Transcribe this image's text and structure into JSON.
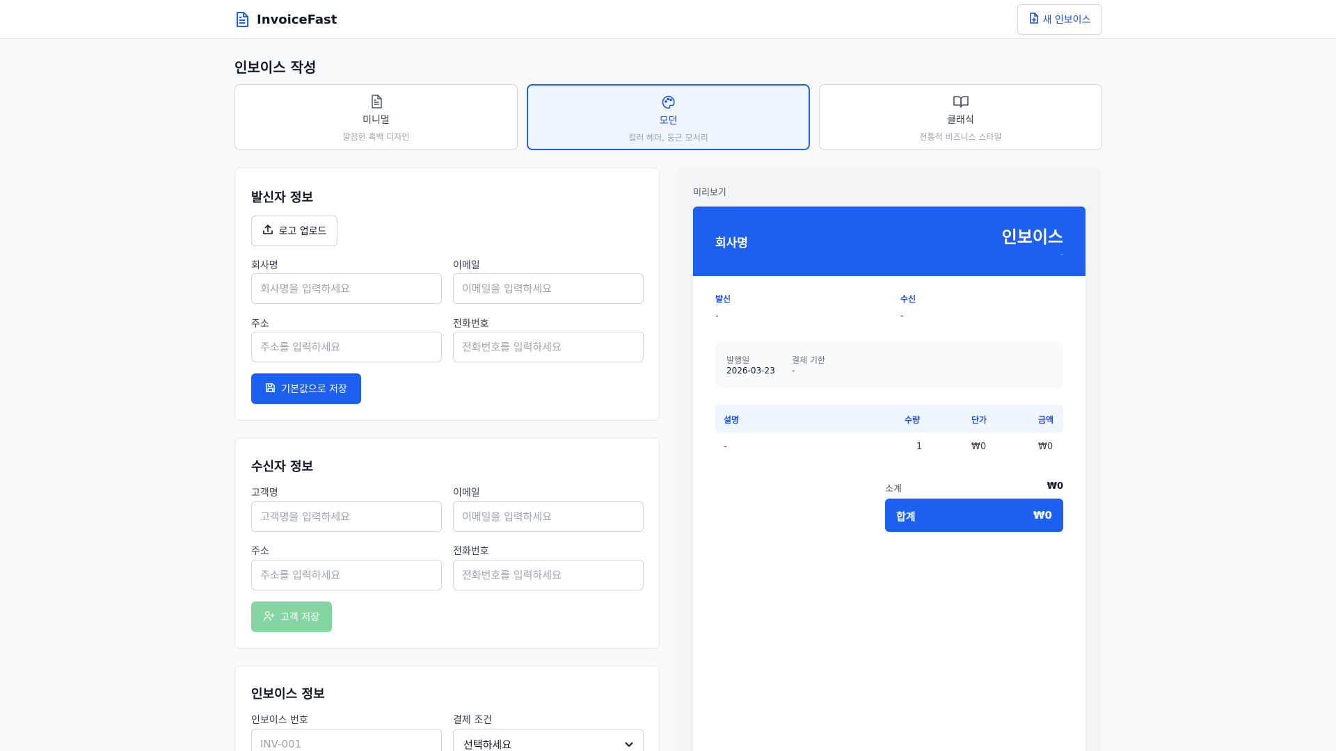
{
  "app": {
    "name": "InvoiceFast",
    "new_invoice_label": "새 인보이스"
  },
  "page": {
    "title": "인보이스 작성"
  },
  "templates": [
    {
      "name": "미니멀",
      "desc": "깔끔한 흑백 디자인",
      "icon": "document-icon",
      "selected": false
    },
    {
      "name": "모던",
      "desc": "컬러 헤더, 둥근 모서리",
      "icon": "palette-icon",
      "selected": true
    },
    {
      "name": "클래식",
      "desc": "전통적 비즈니스 스타일",
      "icon": "book-icon",
      "selected": false
    }
  ],
  "sender": {
    "title": "발신자 정보",
    "upload_label": "로고 업로드",
    "company_label": "회사명",
    "company_placeholder": "회사명을 입력하세요",
    "email_label": "이메일",
    "email_placeholder": "이메일을 입력하세요",
    "address_label": "주소",
    "address_placeholder": "주소를 입력하세요",
    "phone_label": "전화번호",
    "phone_placeholder": "전화번호를 입력하세요",
    "save_label": "기본값으로 저장"
  },
  "recipient": {
    "title": "수신자 정보",
    "name_label": "고객명",
    "name_placeholder": "고객명을 입력하세요",
    "email_label": "이메일",
    "email_placeholder": "이메일을 입력하세요",
    "address_label": "주소",
    "address_placeholder": "주소를 입력하세요",
    "phone_label": "전화번호",
    "phone_placeholder": "전화번호를 입력하세요",
    "save_label": "고객 저장"
  },
  "invoice_info": {
    "title": "인보이스 정보",
    "number_label": "인보이스 번호",
    "number_placeholder": "INV-001",
    "terms_label": "결제 조건",
    "terms_value": "선택하세요"
  },
  "preview": {
    "label": "미리보기",
    "company": "회사명",
    "title": "인보이스",
    "number": "-",
    "from_label": "발신",
    "from_value": "-",
    "to_label": "수신",
    "to_value": "-",
    "issue_label": "발행일",
    "issue_value": "2026-03-23",
    "due_label": "결제 기한",
    "due_value": "-",
    "columns": {
      "desc": "설명",
      "qty": "수량",
      "price": "단가",
      "amount": "금액"
    },
    "row": {
      "desc": "-",
      "qty": "1",
      "price": "₩0",
      "amount": "₩0"
    },
    "subtotal_label": "소계",
    "subtotal_value": "₩0",
    "total_label": "합계",
    "total_value": "₩0"
  },
  "colors": {
    "primary": "#1d60f0",
    "success_disabled": "#86d6a4",
    "background": "#f9fafb"
  }
}
